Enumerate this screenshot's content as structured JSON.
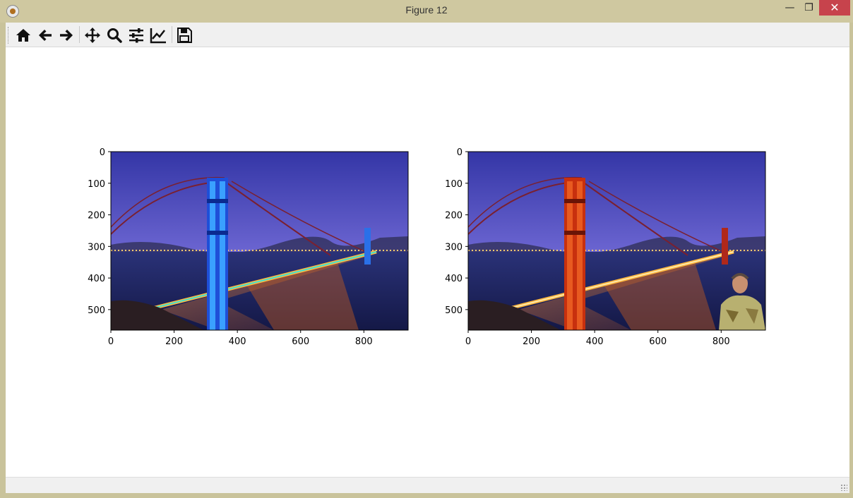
{
  "window": {
    "title": "Figure 12",
    "min_glyph": "—",
    "max_glyph": "❐",
    "close_glyph": "✕"
  },
  "toolbar": {
    "buttons": [
      {
        "name": "home",
        "icon": "home-icon"
      },
      {
        "name": "back",
        "icon": "arrow-left-icon"
      },
      {
        "name": "forward",
        "icon": "arrow-right-icon"
      },
      {
        "name": "pan",
        "icon": "move-icon"
      },
      {
        "name": "zoom",
        "icon": "magnifier-icon"
      },
      {
        "name": "subplots",
        "icon": "sliders-icon"
      },
      {
        "name": "customize",
        "icon": "line-chart-icon"
      },
      {
        "name": "save",
        "icon": "floppy-disk-icon"
      }
    ]
  },
  "plots": [
    {
      "image": "golden-gate-bridge-night-blue-tower",
      "xticks": [
        "0",
        "200",
        "400",
        "600",
        "800"
      ],
      "yticks": [
        "0",
        "100",
        "200",
        "300",
        "400",
        "500"
      ]
    },
    {
      "image": "golden-gate-bridge-night-with-inset-man",
      "xticks": [
        "0",
        "200",
        "400",
        "600",
        "800"
      ],
      "yticks": [
        "0",
        "100",
        "200",
        "300",
        "400",
        "500"
      ]
    }
  ],
  "chart_data": [
    {
      "type": "image",
      "xlim": [
        0,
        940
      ],
      "ylim": [
        565,
        0
      ],
      "tick_values_x": [
        0,
        200,
        400,
        600,
        800
      ],
      "tick_values_y": [
        0,
        100,
        200,
        300,
        400,
        500
      ]
    },
    {
      "type": "image",
      "xlim": [
        0,
        940
      ],
      "ylim": [
        565,
        0
      ],
      "tick_values_x": [
        0,
        200,
        400,
        600,
        800
      ],
      "tick_values_y": [
        0,
        100,
        200,
        300,
        400,
        500
      ]
    }
  ],
  "colors": {
    "sky_top": "#3a3fb0",
    "sky_bottom": "#7a6fd8",
    "tower_left": "#1f4fd8",
    "tower_right": "#c8300e",
    "deck_lights": "#ffb040",
    "water": "#1a1f5a"
  }
}
